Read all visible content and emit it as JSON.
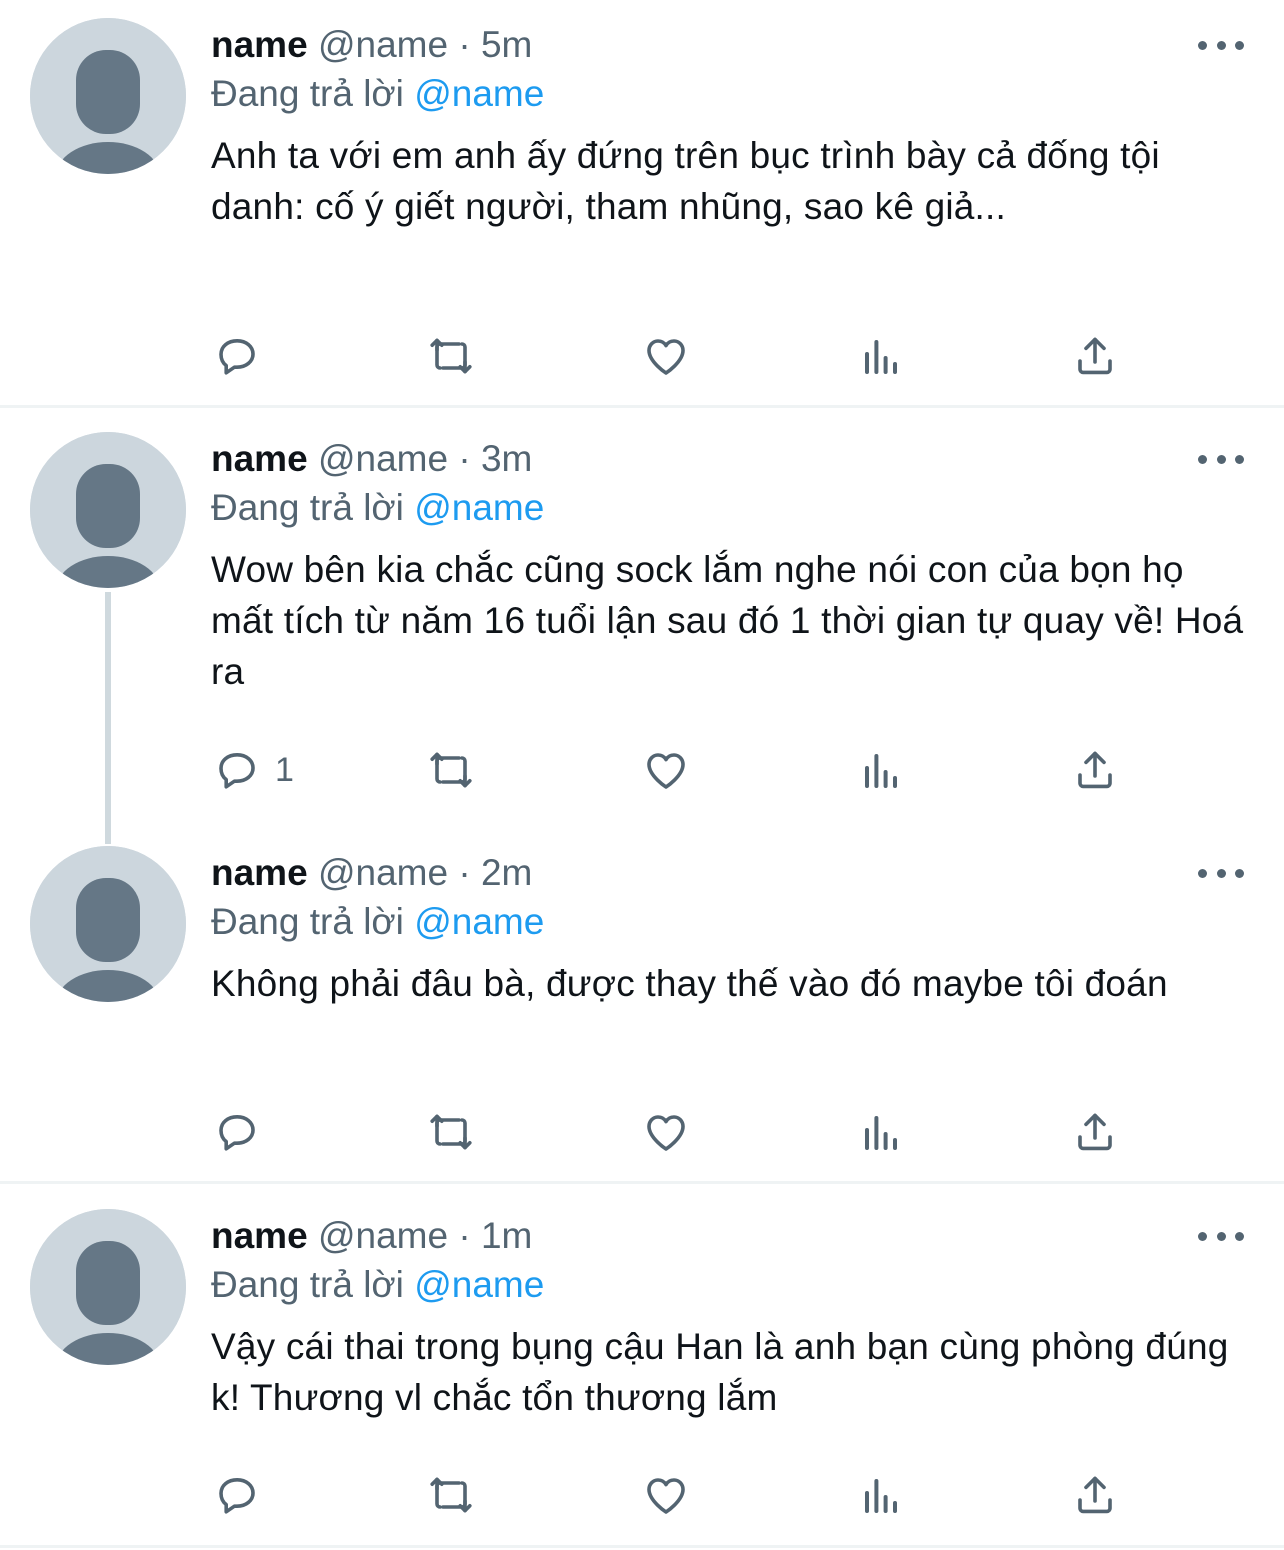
{
  "colors": {
    "accent": "#1d9bf0",
    "secondary_text": "#536471",
    "avatar_bg": "#ccd6dd",
    "avatar_fg": "#657786"
  },
  "reply_prefix": "Đang trả lời",
  "tweets": [
    {
      "name": "name",
      "handle": "@name",
      "time": "5m",
      "reply_to": "@name",
      "text": "Anh ta với em anh ấy đứng trên bục trình bày cả đống tội danh: cố ý giết người, tham nhũng, sao kê giả...",
      "reply_count": ""
    },
    {
      "name": "name",
      "handle": "@name",
      "time": "3m",
      "reply_to": "@name",
      "text": "Wow bên kia chắc cũng sock lắm nghe nói con của bọn họ mất tích từ năm 16 tuổi lận sau đó 1 thời gian tự quay về! Hoá ra",
      "reply_count": "1"
    },
    {
      "name": "name",
      "handle": "@name",
      "time": "2m",
      "reply_to": "@name",
      "text": "Không phải đâu bà, được thay thế vào đó maybe tôi đoán",
      "reply_count": ""
    },
    {
      "name": "name",
      "handle": "@name",
      "time": "1m",
      "reply_to": "@name",
      "text": "Vậy cái thai trong bụng cậu Han là anh bạn cùng phòng đúng k! Thương vl chắc tổn thương lắm",
      "reply_count": ""
    }
  ],
  "separator": "·",
  "icons": [
    "reply-icon",
    "retweet-icon",
    "like-icon",
    "analytics-icon",
    "share-icon",
    "more-icon",
    "avatar-placeholder-icon"
  ]
}
